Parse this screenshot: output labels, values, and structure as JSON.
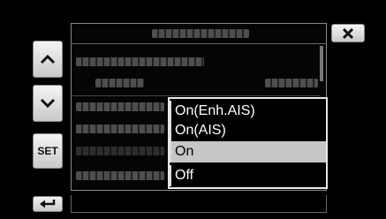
{
  "nav": {
    "set_label": "SET"
  },
  "menu": {
    "options": [
      {
        "label": "On(Enh.AIS)",
        "selected": false
      },
      {
        "label": "On(AIS)",
        "selected": false
      },
      {
        "label": "On",
        "selected": true
      },
      {
        "label": "Off",
        "selected": false
      }
    ]
  },
  "colors": {
    "background": "#000000",
    "button": "#d9d9d9",
    "selected_row": "#c6c6c6",
    "popup_border": "#e8e8e8"
  },
  "icons": [
    "chevron-up-icon",
    "chevron-down-icon",
    "close-icon",
    "back-arrow-icon"
  ]
}
